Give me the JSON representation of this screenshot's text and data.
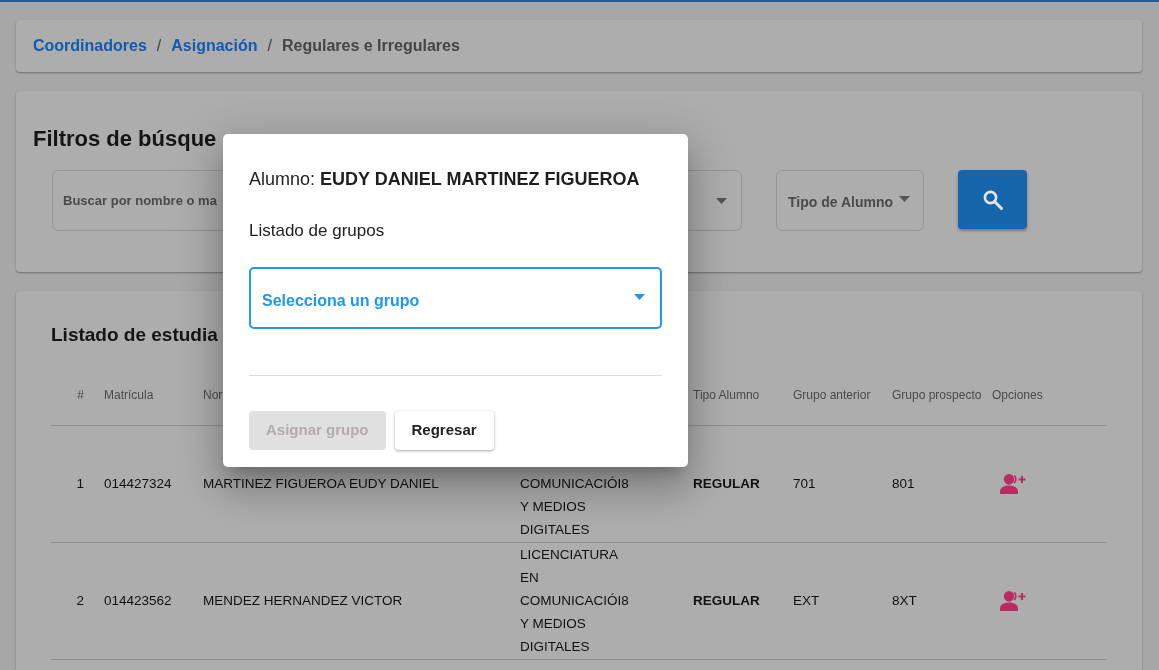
{
  "breadcrumb": [
    {
      "kind": "link",
      "text": "Coordinadores"
    },
    {
      "kind": "separator",
      "text": "/"
    },
    {
      "kind": "link",
      "text": "Asignación"
    },
    {
      "kind": "separator",
      "text": "/"
    },
    {
      "kind": "current",
      "text": "Regulares e Irregulares"
    }
  ],
  "filters": {
    "title": "Filtros de búsque",
    "search": {
      "placeholder": "Buscar por nombre o ma"
    },
    "type_select": {
      "label": "Tipo de Alumno"
    }
  },
  "students": {
    "title": "Listado de estudia",
    "columns": [
      {
        "label": "#"
      },
      {
        "label": "Matrícula"
      },
      {
        "label": "Nor"
      },
      {},
      {
        "label": "Tipo Alumno"
      },
      {
        "label": "Grupo anterior"
      },
      {
        "label": "Grupo prospecto"
      },
      {
        "label": "Opciones"
      }
    ],
    "rows": [
      {
        "cells": [
          {
            "kind": "text",
            "text": "1"
          },
          {
            "kind": "text",
            "text": "014427324"
          },
          {
            "kind": "text",
            "text": "MARTINEZ FIGUEROA EUDY DANIEL"
          },
          {
            "kind": "text",
            "text": "COMUNICACIÓI8 Y MEDIOS DIGITALES"
          },
          {
            "kind": "strong",
            "text": "REGULAR"
          },
          {
            "kind": "text",
            "text": "701"
          },
          {
            "kind": "text",
            "text": "801"
          },
          {
            "kind": "action"
          }
        ]
      },
      {
        "cells": [
          {
            "kind": "text",
            "text": "2"
          },
          {
            "kind": "text",
            "text": "014423562"
          },
          {
            "kind": "text",
            "text": "MENDEZ HERNANDEZ VICTOR"
          },
          {
            "kind": "text",
            "text": "LICENCIATURA EN COMUNICACIÓI8 Y MEDIOS DIGITALES"
          },
          {
            "kind": "strong",
            "text": "REGULAR"
          },
          {
            "kind": "text",
            "text": "EXT"
          },
          {
            "kind": "text",
            "text": "8XT"
          },
          {
            "kind": "action"
          }
        ]
      }
    ]
  },
  "modal": {
    "title": "Alumno: **EUDY DANIEL MARTINEZ FIGUEROA**",
    "field_label": "Listado de grupos",
    "group_select": {
      "placeholder": "Selecciona un grupo"
    },
    "buttons": [
      {
        "label": "Asignar grupo",
        "disabled": true
      },
      {
        "label": "Regresar",
        "disabled": false
      }
    ]
  }
}
